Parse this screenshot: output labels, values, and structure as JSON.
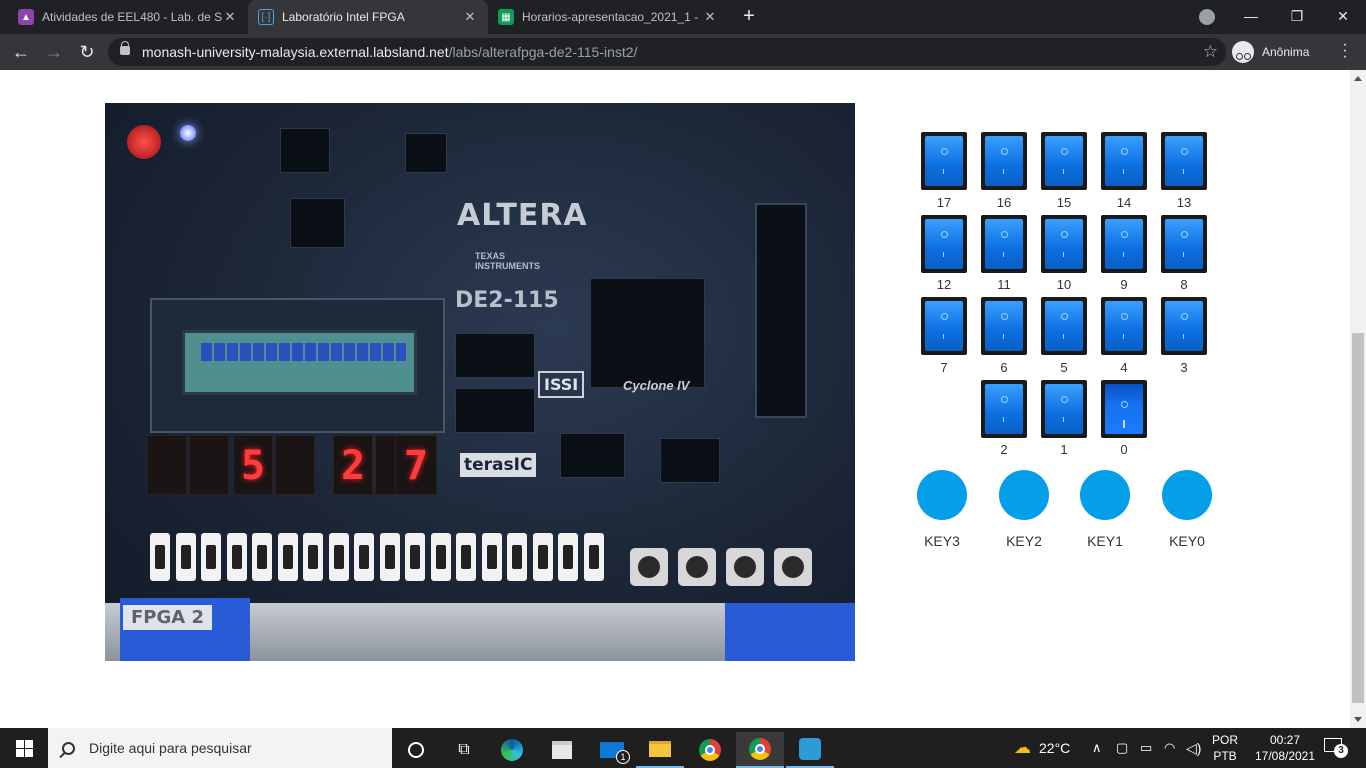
{
  "browser": {
    "tabs": [
      {
        "title": "Atividades de EEL480 - Lab. de Si",
        "favicon": "classroom-icon",
        "color": "#8e44ad",
        "active": false
      },
      {
        "title": "Laboratório Intel FPGA",
        "favicon": "labsland-icon",
        "color": "#4aa3df",
        "active": true
      },
      {
        "title": "Horarios-apresentacao_2021_1 -",
        "favicon": "sheets-icon",
        "color": "#0f9d58",
        "active": false
      }
    ],
    "new_tab": "+",
    "url_host": "monash-university-malaysia.external.labsland.net",
    "url_path": "/labs/alterafpga-de2-115-inst2/",
    "profile_label": "Anônima"
  },
  "camera": {
    "brand": "ALTERA",
    "ti_line1": "TEXAS",
    "ti_line2": "INSTRUMENTS",
    "model": "DE2-115",
    "issi": "ISSI",
    "cyclone": "Cyclone IV",
    "terasic": "terasIC",
    "board_label": "FPGA 2",
    "hex_display": [
      "",
      "",
      "5",
      "",
      "2",
      "",
      "7",
      ""
    ]
  },
  "switches": {
    "rows": [
      [
        {
          "label": "17",
          "on": false
        },
        {
          "label": "16",
          "on": false
        },
        {
          "label": "15",
          "on": false
        },
        {
          "label": "14",
          "on": false
        },
        {
          "label": "13",
          "on": false
        }
      ],
      [
        {
          "label": "12",
          "on": false
        },
        {
          "label": "11",
          "on": false
        },
        {
          "label": "10",
          "on": false
        },
        {
          "label": "9",
          "on": false
        },
        {
          "label": "8",
          "on": false
        }
      ],
      [
        {
          "label": "7",
          "on": false
        },
        {
          "label": "6",
          "on": false
        },
        {
          "label": "5",
          "on": false
        },
        {
          "label": "4",
          "on": false
        },
        {
          "label": "3",
          "on": false
        }
      ],
      [
        {
          "label": "2",
          "on": false
        },
        {
          "label": "1",
          "on": false
        },
        {
          "label": "0",
          "on": true
        }
      ]
    ]
  },
  "keys": [
    {
      "label": "KEY3"
    },
    {
      "label": "KEY2"
    },
    {
      "label": "KEY1"
    },
    {
      "label": "KEY0"
    }
  ],
  "colors": {
    "key_blue": "#049ee9",
    "switch_blue": "#0b6fe0"
  },
  "taskbar": {
    "search_placeholder": "Digite aqui para pesquisar",
    "mail_badge": "1",
    "weather": "22°C",
    "lang_line1": "POR",
    "lang_line2": "PTB",
    "time": "00:27",
    "date": "17/08/2021",
    "notifications": "3"
  }
}
